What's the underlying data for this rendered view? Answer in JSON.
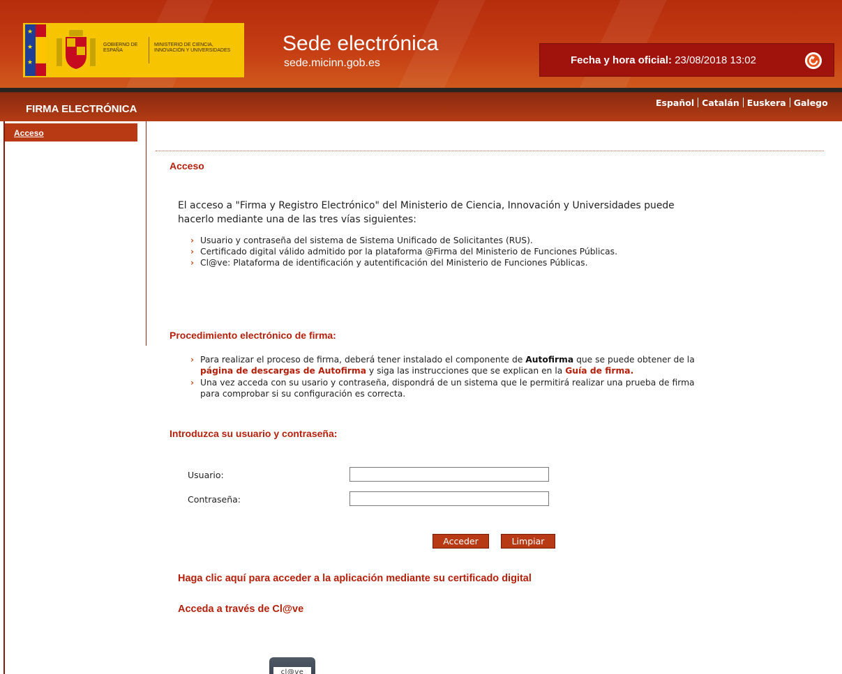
{
  "header": {
    "gov_left": "GOBIERNO DE ESPAÑA",
    "gov_right": "MINISTERIO DE CIENCIA, INNOVACIÓN Y UNIVERSIDADES",
    "site_title": "Sede electrónica",
    "site_url": "sede.micinn.gob.es",
    "clock_label": "Fecha y hora oficial:",
    "clock_value": "23/08/2018 13:02"
  },
  "titlebar": {
    "section_title": "FIRMA ELECTRÓNICA",
    "languages": [
      "Español",
      "Catalán",
      "Euskera",
      "Galego"
    ]
  },
  "sidebar": {
    "items": [
      {
        "label": "Acceso"
      }
    ]
  },
  "main": {
    "heading_access": "Acceso",
    "intro_line1": "El acceso a \"Firma y Registro Electrónico\" del Ministerio de Ciencia, Innovación y Universidades puede",
    "intro_line2": "hacerlo mediante una de las tres vías siguientes:",
    "access_options": [
      "Usuario y contraseña del sistema de Sistema Unificado de Solicitantes (RUS).",
      "Certificado digital válido admitido por la plataforma @Firma del Ministerio de Funciones Públicas.",
      "Cl@ve: Plataforma de identificación y autentificación del Ministerio de Funciones Públicas."
    ],
    "heading_procedure": "Procedimiento electrónico de firma:",
    "proc1_a": "Para realizar el proceso de firma, deberá tener instalado el componente de ",
    "proc1_b": "Autofirma",
    "proc1_c": " que se puede obtener de la",
    "proc1_d": "página de descargas de Autofirma",
    "proc1_e": " y siga las instrucciones que se explican en la ",
    "proc1_f": "Guía de firma.",
    "proc2_line1": "Una vez acceda con su usario y contraseña, dispondrá de un sistema que le permitirá realizar una prueba de firma",
    "proc2_line2": "para comprobar si su configuración es correcta.",
    "heading_login": "Introduzca su usuario y contraseña:",
    "user_label": "Usuario:",
    "user_value": "",
    "password_label": "Contraseña:",
    "password_value": "",
    "btn_submit": "Acceder",
    "btn_clear": "Limpiar",
    "link_certificate": "Haga clic aquí para acceder a la aplicación mediante su certificado digital",
    "link_clave": "Acceda a través de Cl@ve",
    "clave_logo_text": "cl@ve"
  },
  "colors": {
    "brand_red": "#b5200a",
    "header_orange": "#c43c13",
    "gov_yellow": "#f6c400"
  },
  "icons": [
    "refresh-icon",
    "clave-logo-icon",
    "coat-of-arms-icon",
    "flag-icon"
  ]
}
